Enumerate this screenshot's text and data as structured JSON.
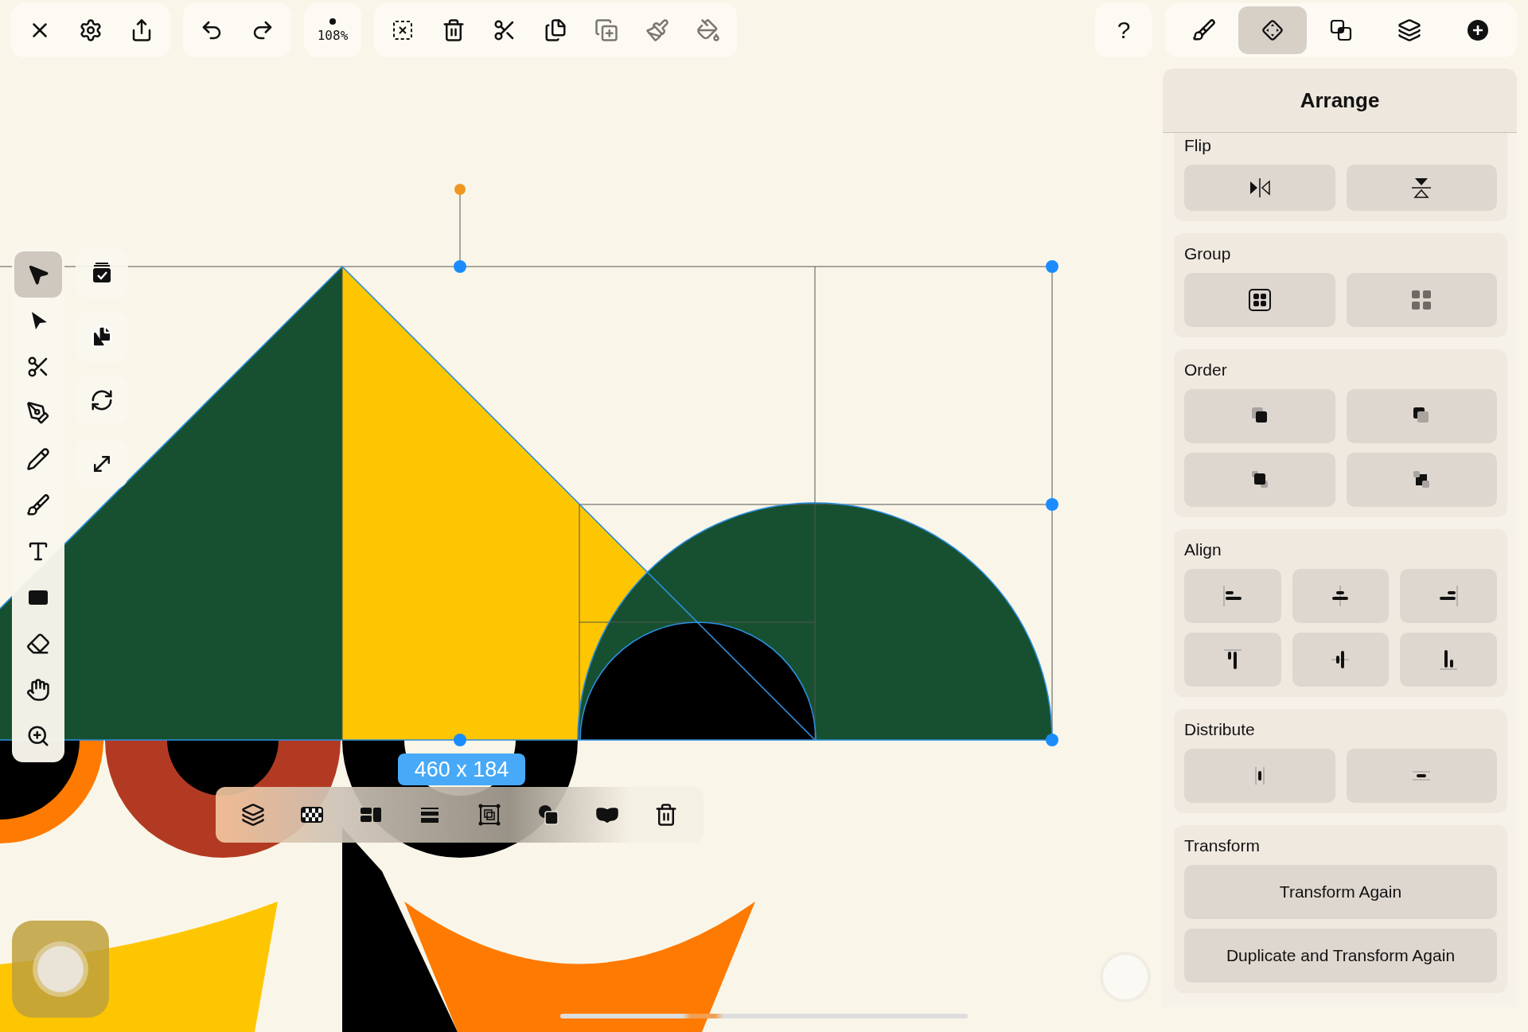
{
  "top_bar": {
    "edit_tools": [
      {
        "disabled": false
      },
      {
        "disabled": false
      },
      {
        "disabled": false
      },
      {
        "disabled": false
      },
      {
        "disabled": true
      },
      {
        "disabled": true
      },
      {
        "disabled": true
      }
    ],
    "zoom": {
      "label": "108%"
    },
    "help": {
      "label": "?"
    },
    "inspector_tabs": [
      {
        "selected": false
      },
      {
        "selected": true
      },
      {
        "selected": false
      },
      {
        "selected": false
      },
      {
        "selected": false
      }
    ]
  },
  "tools": [
    {
      "selected": true
    },
    {
      "selected": false
    },
    {
      "selected": false
    },
    {
      "selected": false
    },
    {
      "selected": false
    },
    {
      "selected": false
    },
    {
      "selected": false
    },
    {
      "selected": false
    },
    {
      "selected": false
    },
    {
      "selected": false
    },
    {
      "selected": false
    }
  ],
  "canvas": {
    "dimension_label": "460 x 184"
  },
  "inspector": {
    "title": "Arrange",
    "sections": [
      {
        "kind": "flip",
        "title": "Flip"
      },
      {
        "kind": "group",
        "title": "Group",
        "buttons": [
          {
            "disabled": false
          },
          {
            "disabled": true
          }
        ]
      },
      {
        "kind": "order",
        "title": "Order"
      },
      {
        "kind": "align",
        "title": "Align"
      },
      {
        "kind": "distribute",
        "title": "Distribute"
      },
      {
        "kind": "transform",
        "title": "Transform",
        "buttons": [
          "Transform Again",
          "Duplicate and Transform Again"
        ]
      }
    ]
  }
}
